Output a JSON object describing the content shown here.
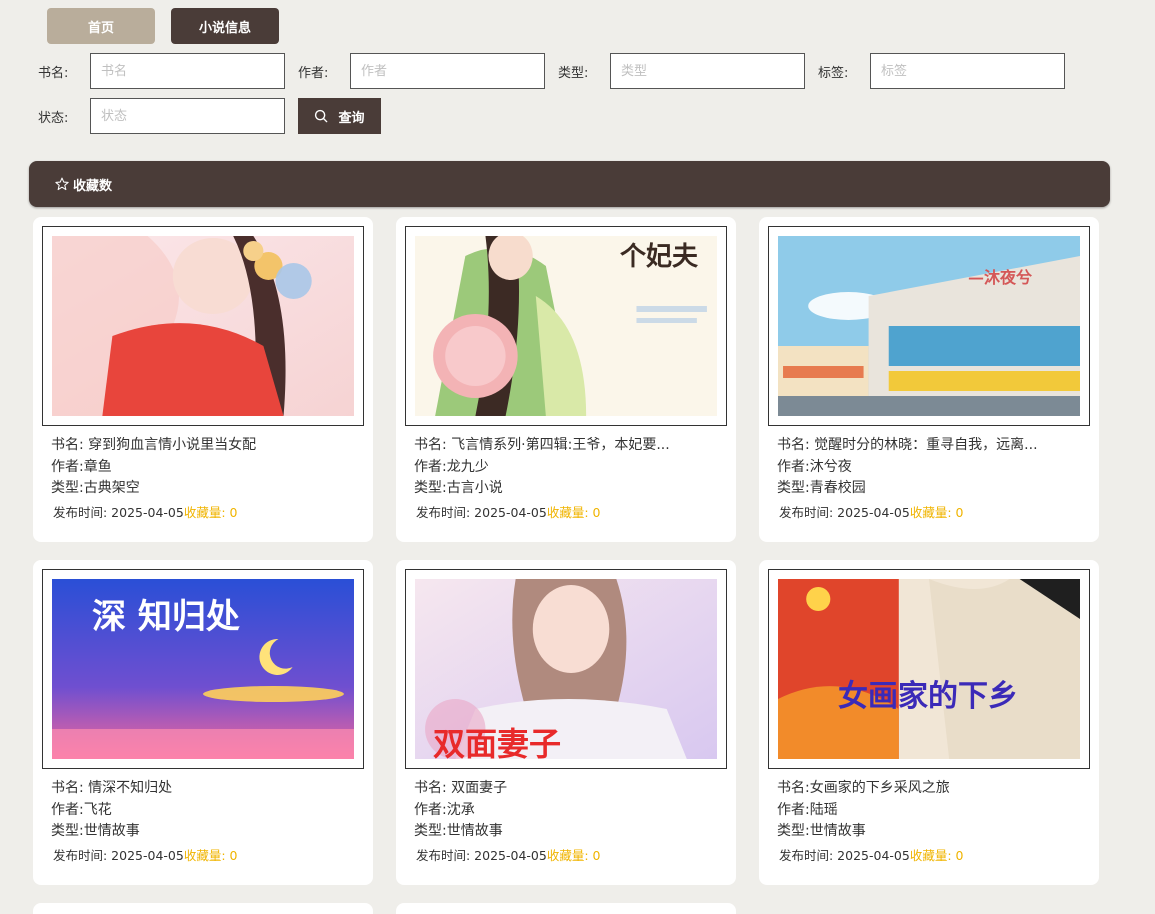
{
  "nav": {
    "home": "首页",
    "novel_info": "小说信息"
  },
  "filters": {
    "title_label": "书名:",
    "title_placeholder": "书名",
    "author_label": "作者:",
    "author_placeholder": "作者",
    "type_label": "类型:",
    "type_placeholder": "类型",
    "tag_label": "标签:",
    "tag_placeholder": "标签",
    "status_label": "状态:",
    "status_placeholder": "状态",
    "search_label": "查询"
  },
  "section": {
    "label": "收藏数",
    "icon": "star-icon"
  },
  "cards": [
    {
      "title": "书名: 穿到狗血言情小说里当女配",
      "author": "作者:章鱼",
      "type": "类型:古典架空",
      "date": "发布时间: 2025-04-05",
      "fav": "收藏量: 0",
      "cover_text": ""
    },
    {
      "title": "书名: 飞言情系列·第四辑:王爷，本妃要...",
      "author": "作者:龙九少",
      "type": "类型:古言小说",
      "date": "发布时间: 2025-04-05",
      "fav": "收藏量: 0",
      "cover_text": "个妃夫"
    },
    {
      "title": "书名: 觉醒时分的林晓：重寻自我，远离...",
      "author": "作者:沐兮夜",
      "type": "类型:青春校园",
      "date": "发布时间: 2025-04-05",
      "fav": "收藏量: 0",
      "cover_text": "—沐夜兮"
    },
    {
      "title": "书名: 情深不知归处",
      "author": "作者:飞花",
      "type": "类型:世情故事",
      "date": "发布时间: 2025-04-05",
      "fav": "收藏量: 0",
      "cover_text": "深 知归处"
    },
    {
      "title": "书名: 双面妻子",
      "author": "作者:沈承",
      "type": "类型:世情故事",
      "date": "发布时间: 2025-04-05",
      "fav": "收藏量: 0",
      "cover_text": "双面妻子"
    },
    {
      "title": "书名:女画家的下乡采风之旅",
      "author": "作者:陆瑶",
      "type": "类型:世情故事",
      "date": "发布时间: 2025-04-05",
      "fav": "收藏量: 0",
      "cover_text": "女画家的下乡"
    }
  ],
  "colors": {
    "primary": "#4a3c38",
    "home_btn": "#b9ad9b",
    "background": "#efeeea",
    "fav": "#f0b400"
  }
}
